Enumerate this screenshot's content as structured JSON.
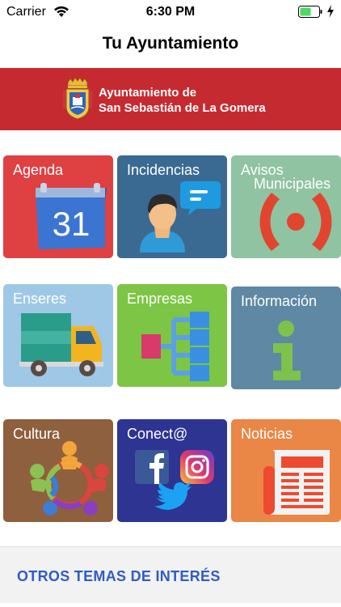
{
  "status_bar": {
    "carrier": "Carrier",
    "time": "6:30 PM",
    "icons": [
      "wifi-icon",
      "battery-icon",
      "charging-icon"
    ]
  },
  "nav": {
    "title": "Tu Ayuntamiento"
  },
  "banner": {
    "line1": "Ayuntamiento de",
    "line2": "San Sebastián de La Gomera",
    "background": "#c62a31"
  },
  "tiles": [
    {
      "label": "Agenda",
      "icon": "calendar-icon",
      "calendar_day": "31",
      "color": "#df4041"
    },
    {
      "label": "Incidencias",
      "icon": "person-chat-icon",
      "color": "#3a6a92"
    },
    {
      "label": "Avisos",
      "label2": "Municipales",
      "icon": "broadcast-icon",
      "color": "#8fc3a1"
    },
    {
      "label": "Enseres",
      "icon": "truck-icon",
      "color": "#9fc8e6"
    },
    {
      "label": "Empresas",
      "icon": "org-chart-icon",
      "color": "#7dc544"
    },
    {
      "label": "Información",
      "icon": "info-icon",
      "color": "#5e88a4"
    },
    {
      "label": "Cultura",
      "icon": "people-circle-icon",
      "color": "#8e603d"
    },
    {
      "label": "Conect@",
      "icon": "social-media-icon",
      "color": "#2d3491"
    },
    {
      "label": "Noticias",
      "icon": "newspaper-icon",
      "color": "#ea8646"
    }
  ],
  "footer": {
    "label": "OTROS TEMAS DE INTERÉS",
    "color": "#2f5cc5"
  }
}
